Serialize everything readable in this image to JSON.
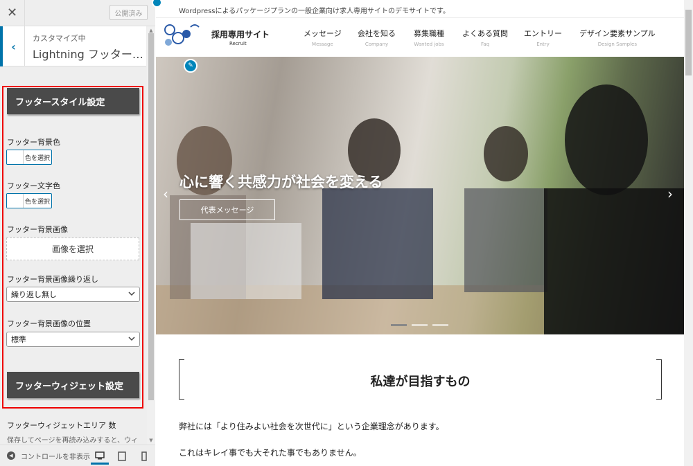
{
  "customizer": {
    "close_glyph": "✕",
    "publish_label": "公開済み",
    "section_sub": "カスタマイズ中",
    "section_title": "Lightning フッター…",
    "back_glyph": "‹",
    "footer_style_header": "フッタースタイル設定",
    "bg_color_label": "フッター背景色",
    "bg_color_button": "色を選択",
    "text_color_label": "フッター文字色",
    "text_color_button": "色を選択",
    "bg_image_label": "フッター背景画像",
    "bg_image_button": "画像を選択",
    "bg_repeat_label": "フッター背景画像繰り返し",
    "bg_repeat_value": "繰り返し無し",
    "bg_position_label": "フッター背景画像の位置",
    "bg_position_value": "標準",
    "widget_header": "フッターウィジェット設定",
    "widget_count_label": "フッターウィジェットエリア 数",
    "widget_count_desc": "保存してページを再読み込みすると、ウィ",
    "footer": {
      "collapse_label": "コントロールを非表示",
      "devices": [
        "desktop-icon",
        "tablet-icon",
        "mobile-icon"
      ]
    },
    "accent_color": "#0073aa",
    "highlight_color": "#e00000"
  },
  "preview": {
    "topbar_text": "Wordpressによるパッケージプランの一般企業向け求人専用サイトのデモサイトです。",
    "site_name": "採用専用サイト",
    "site_sub": "Recruit",
    "nav": [
      {
        "main": "メッセージ",
        "sub": "Message"
      },
      {
        "main": "会社を知る",
        "sub": "Company"
      },
      {
        "main": "募集職種",
        "sub": "Wanted jobs"
      },
      {
        "main": "よくある質問",
        "sub": "Faq"
      },
      {
        "main": "エントリー",
        "sub": "Entry"
      },
      {
        "main": "デザイン要素サンプル",
        "sub": "Design Samples"
      }
    ],
    "hero_title": "心に響く共感力が社会を変える",
    "hero_button": "代表メッセージ",
    "prev_arrow": "‹",
    "next_arrow": "›",
    "section_title": "私達が目指すもの",
    "para1": "弊社には「より住みよい社会を次世代に」という企業理念があります。",
    "para2": "これはキレイ事でも大それた事でもありません。"
  }
}
